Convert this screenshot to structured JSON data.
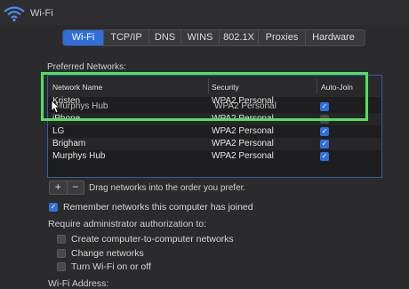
{
  "window": {
    "title": "Wi-Fi"
  },
  "tabs": [
    {
      "label": "Wi-Fi",
      "active": true
    },
    {
      "label": "TCP/IP",
      "active": false
    },
    {
      "label": "DNS",
      "active": false
    },
    {
      "label": "WINS",
      "active": false
    },
    {
      "label": "802.1X",
      "active": false
    },
    {
      "label": "Proxies",
      "active": false
    },
    {
      "label": "Hardware",
      "active": false
    }
  ],
  "preferred": {
    "label": "Preferred Networks:",
    "columns": {
      "name": "Network Name",
      "security": "Security",
      "autojoin": "Auto-Join"
    },
    "rows": [
      {
        "name": "Kristen",
        "security": "WPA2 Personal",
        "auto_join": true,
        "overlay_name": "Murphys Hub",
        "overlay_security": "WPA2 Personal"
      },
      {
        "name": "iPhone",
        "security": "WPA2 Personal",
        "auto_join": false
      },
      {
        "name": "LG",
        "security": "WPA2 Personal",
        "auto_join": true
      },
      {
        "name": "Brigham",
        "security": "WPA2 Personal",
        "auto_join": true
      },
      {
        "name": "Murphys Hub",
        "security": "WPA2 Personal",
        "auto_join": true
      }
    ]
  },
  "controls": {
    "add_label": "+",
    "remove_label": "−",
    "hint": "Drag networks into the order you prefer."
  },
  "options": {
    "remember": {
      "label": "Remember networks this computer has joined",
      "checked": true
    },
    "admin_label": "Require administrator authorization to:",
    "admin_items": [
      {
        "label": "Create computer-to-computer networks",
        "checked": false
      },
      {
        "label": "Change networks",
        "checked": false
      },
      {
        "label": "Turn Wi-Fi on or off",
        "checked": false
      }
    ],
    "address_label": "Wi-Fi Address:"
  },
  "colors": {
    "accent": "#2f6fdc",
    "highlight": "#51e15a",
    "background": "#2b2b2d"
  }
}
